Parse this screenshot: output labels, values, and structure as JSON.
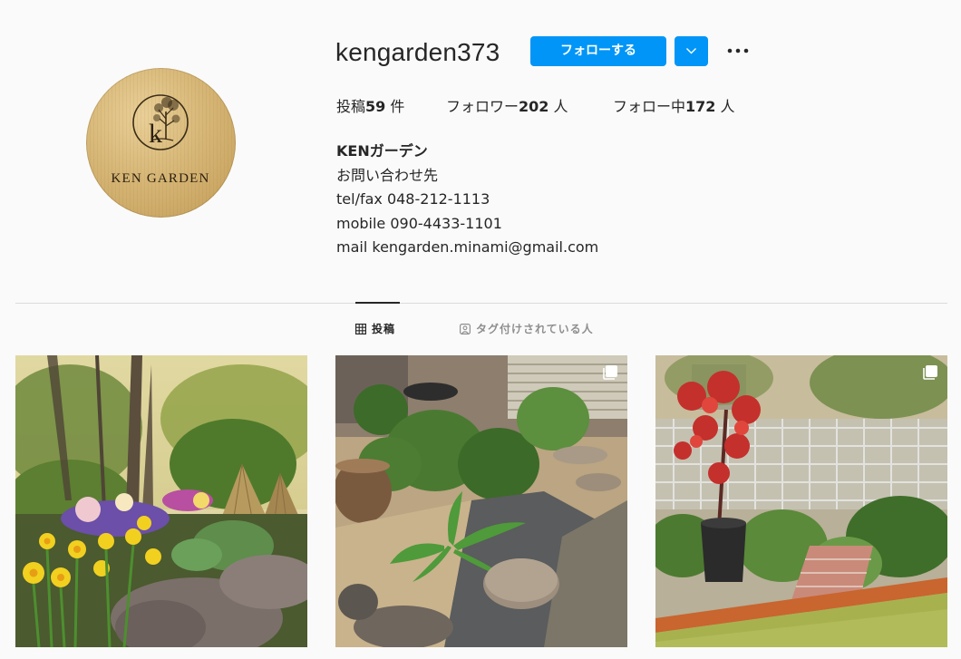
{
  "profile": {
    "username": "kengarden373",
    "follow_label": "フォローする",
    "avatar_text": "KEN GARDEN",
    "avatar_monogram": "k"
  },
  "stats": {
    "posts_label": "投稿",
    "posts_count": "59",
    "posts_unit": "件",
    "followers_label": "フォロワー",
    "followers_count": "202",
    "followers_unit": "人",
    "following_label": "フォロー中",
    "following_count": "172",
    "following_unit": "人"
  },
  "bio": {
    "name": "KENガーデン",
    "lines": [
      "お問い合わせ先",
      "tel/fax 048-212-1113",
      "mobile 090-4433-1101",
      "mail kengarden.minami@gmail.com"
    ]
  },
  "tabs": [
    {
      "label": "投稿",
      "icon": "grid-icon",
      "active": true
    },
    {
      "label": "タグ付けされている人",
      "icon": "tagged-icon",
      "active": false
    }
  ],
  "posts": [
    {
      "icon": "multiple-photos-icon"
    },
    {
      "icon": "multiple-photos-icon"
    },
    {
      "icon": "multiple-photos-icon"
    }
  ],
  "colors": {
    "primary_button": "#0095f6",
    "text": "#262626",
    "muted_text": "#8e8e8e",
    "divider": "#dbdbdb",
    "background": "#fafafa"
  }
}
